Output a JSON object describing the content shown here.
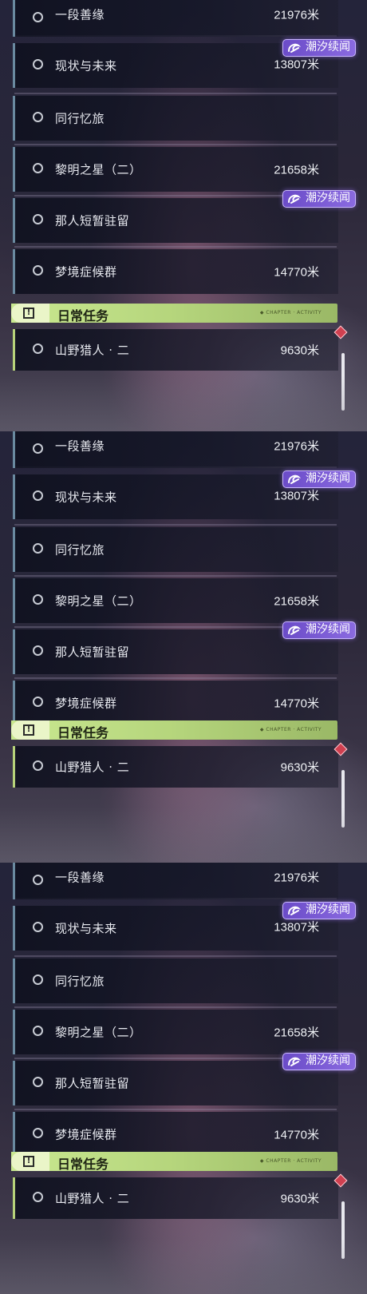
{
  "panels": [
    {
      "quests": [
        {
          "name": "一段善缘",
          "distance": "21976米",
          "tag": ""
        },
        {
          "name": "现状与未来",
          "distance": "13807米",
          "tag": "潮汐续闻"
        },
        {
          "name": "同行忆旅",
          "distance": "",
          "tag": ""
        },
        {
          "name": "黎明之星（二）",
          "distance": "21658米",
          "tag": ""
        },
        {
          "name": "那人短暂驻留",
          "distance": "",
          "tag": "潮汐续闻"
        },
        {
          "name": "梦境症候群",
          "distance": "14770米",
          "tag": ""
        }
      ],
      "daily": {
        "header": "日常任务",
        "header_deco": "◆ CHAPTER · ACTIVITY",
        "name": "山野猎人 · 二",
        "distance": "9630米"
      }
    },
    {
      "quests": [
        {
          "name": "一段善缘",
          "distance": "21976米",
          "tag": ""
        },
        {
          "name": "现状与未来",
          "distance": "13807米",
          "tag": "潮汐续闻"
        },
        {
          "name": "同行忆旅",
          "distance": "",
          "tag": ""
        },
        {
          "name": "黎明之星（二）",
          "distance": "21658米",
          "tag": ""
        },
        {
          "name": "那人短暂驻留",
          "distance": "",
          "tag": "潮汐续闻"
        },
        {
          "name": "梦境症候群",
          "distance": "14770米",
          "tag": ""
        }
      ],
      "daily": {
        "header": "日常任务",
        "header_deco": "◆ CHAPTER · ACTIVITY",
        "name": "山野猎人 · 二",
        "distance": "9630米"
      }
    },
    {
      "quests": [
        {
          "name": "一段善缘",
          "distance": "21976米",
          "tag": ""
        },
        {
          "name": "现状与未来",
          "distance": "13807米",
          "tag": "潮汐续闻"
        },
        {
          "name": "同行忆旅",
          "distance": "",
          "tag": ""
        },
        {
          "name": "黎明之星（二）",
          "distance": "21658米",
          "tag": ""
        },
        {
          "name": "那人短暂驻留",
          "distance": "",
          "tag": "潮汐续闻"
        },
        {
          "name": "梦境症候群",
          "distance": "14770米",
          "tag": ""
        }
      ],
      "daily": {
        "header": "日常任务",
        "header_deco": "◆ CHAPTER · ACTIVITY",
        "name": "山野猎人 · 二",
        "distance": "9630米"
      }
    }
  ],
  "colors": {
    "accent_quest_border": "#6a8aa0",
    "daily_header": "#c9e890",
    "tag_purple": "#7a5ad8",
    "tracker_diamond": "#d04050"
  },
  "icons": {
    "quest_status": "circle-outline-icon",
    "tag": "tidal-swirl-icon",
    "daily_header": "exclamation-box-icon",
    "tracker": "red-diamond-icon"
  }
}
